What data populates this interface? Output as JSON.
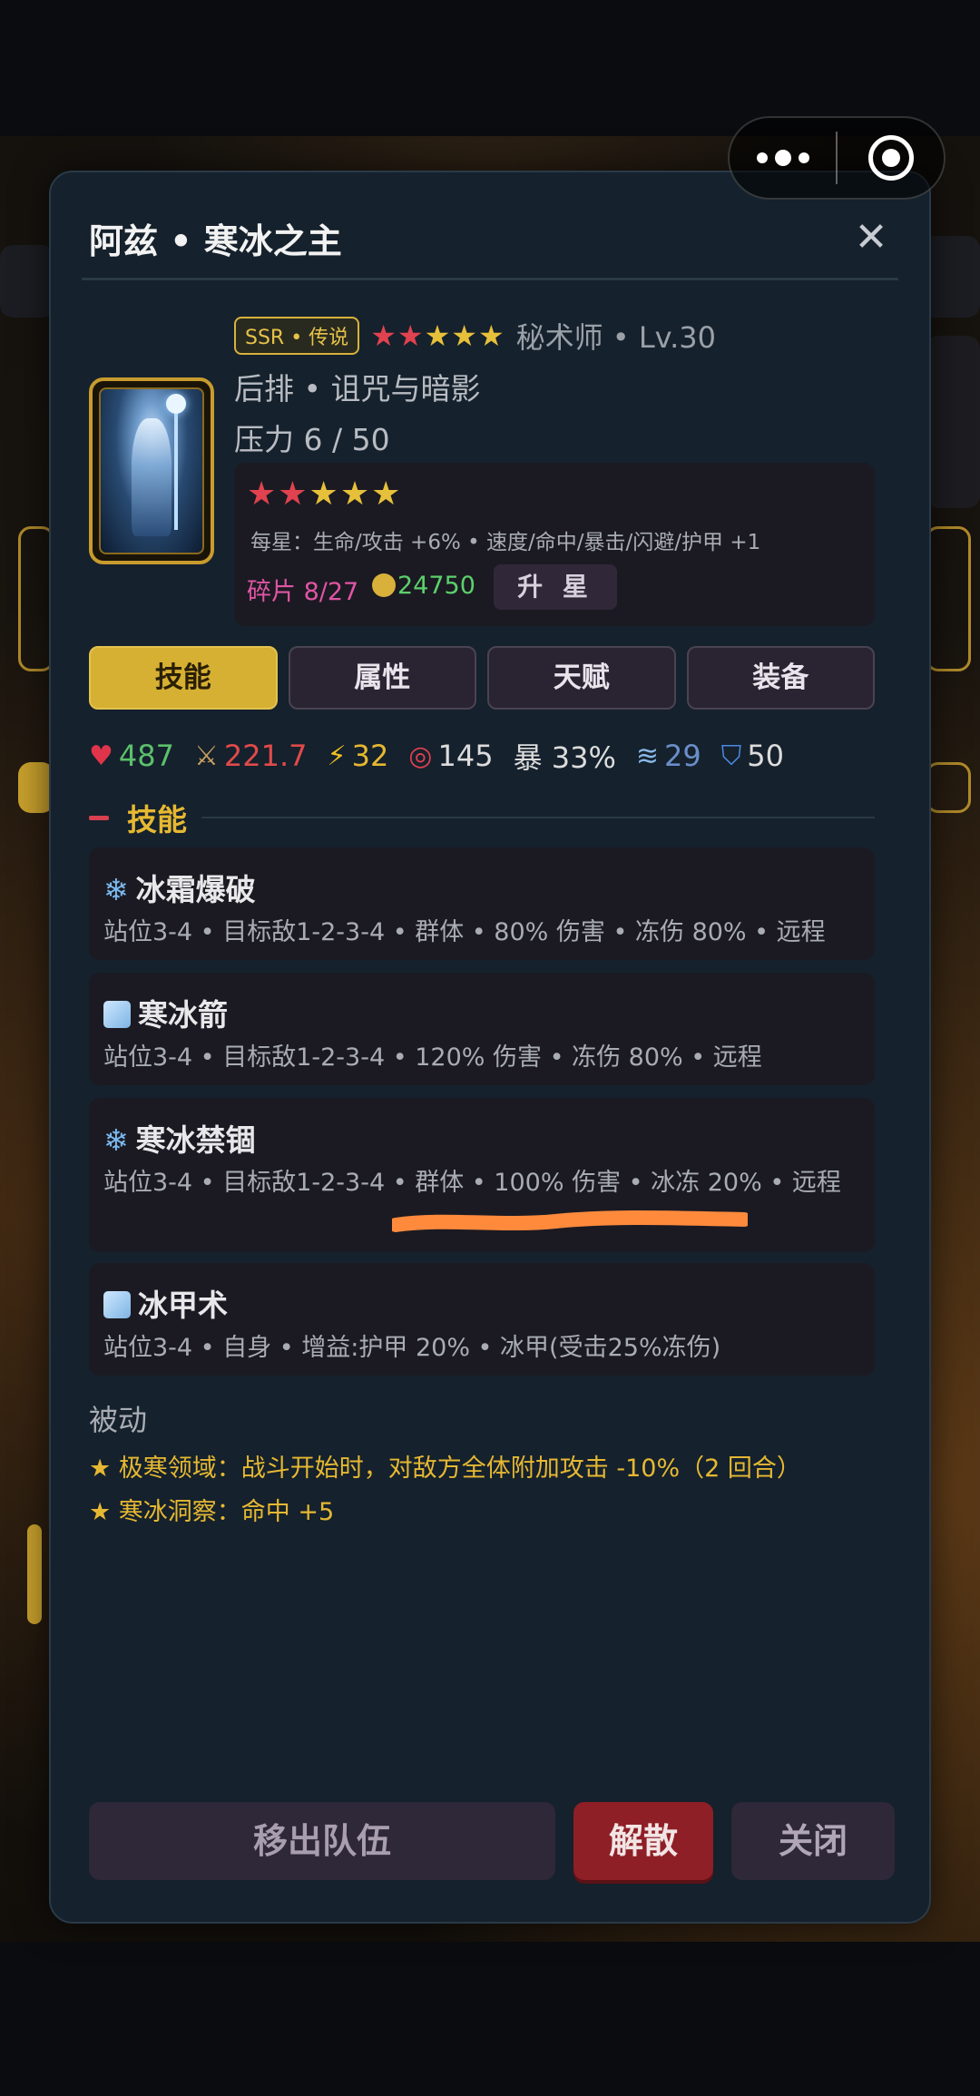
{
  "header": {
    "title": "阿兹 • 寒冰之主",
    "close_glyph": "✕"
  },
  "hero": {
    "rarity": "SSR • 传说",
    "stars_red": "★★",
    "stars_yellow": "★★★",
    "class_level": "秘术师 • Lv.30",
    "position_traits": "后排 • 诅咒与暗影",
    "pressure": "压力 6 / 50"
  },
  "star_panel": {
    "stars_red": "★★",
    "stars_yellow": "★★★",
    "bonus": "每星：生命/攻击 +6% • 速度/命中/暴击/闪避/护甲 +1",
    "shards": "碎片 8/27",
    "gold": "24750",
    "upgrade_label": "升 星"
  },
  "tabs": [
    {
      "label": "技能",
      "active": true
    },
    {
      "label": "属性",
      "active": false
    },
    {
      "label": "天赋",
      "active": false
    },
    {
      "label": "装备",
      "active": false
    }
  ],
  "stats": {
    "hp": "487",
    "attack": "221.7",
    "speed": "32",
    "accuracy": "145",
    "crit": "暴 33%",
    "dodge": "29",
    "armor": "50",
    "icons": [
      "heart-icon",
      "swords-icon",
      "lightning-icon",
      "target-icon",
      "wind-icon",
      "shield-icon"
    ]
  },
  "skills_section": {
    "title": "技能",
    "skills": [
      {
        "icon": "snowflake-icon",
        "name": "冰霜爆破",
        "desc": "站位3-4 • 目标敌1-2-3-4 • 群体 • 80% 伤害 • 冻伤 80% • 远程"
      },
      {
        "icon": "ice-cube-icon",
        "name": "寒冰箭",
        "desc": "站位3-4 • 目标敌1-2-3-4 • 120% 伤害 • 冻伤 80% • 远程"
      },
      {
        "icon": "snowflake-icon",
        "name": "寒冰禁锢",
        "desc": "站位3-4 • 目标敌1-2-3-4 • 群体 • 100% 伤害 • 冰冻 20% • 远程"
      },
      {
        "icon": "ice-cube-icon",
        "name": "冰甲术",
        "desc": "站位3-4 • 自身 • 增益:护甲 20% • 冰甲(受击25%冻伤)"
      }
    ]
  },
  "passive": {
    "title": "被动",
    "items": [
      "★ 极寒领域：战斗开始时，对敌方全体附加攻击 -10%（2 回合）",
      "★ 寒冰洞察：命中 +5"
    ]
  },
  "footer": {
    "leave_label": "移出队伍",
    "dismiss_label": "解散",
    "close_label": "关闭"
  },
  "colors": {
    "accent_gold": "#d6b032",
    "danger_red": "#8e1f26",
    "modal_bg": "#15212c",
    "annotation_orange": "#ff8a3c"
  }
}
